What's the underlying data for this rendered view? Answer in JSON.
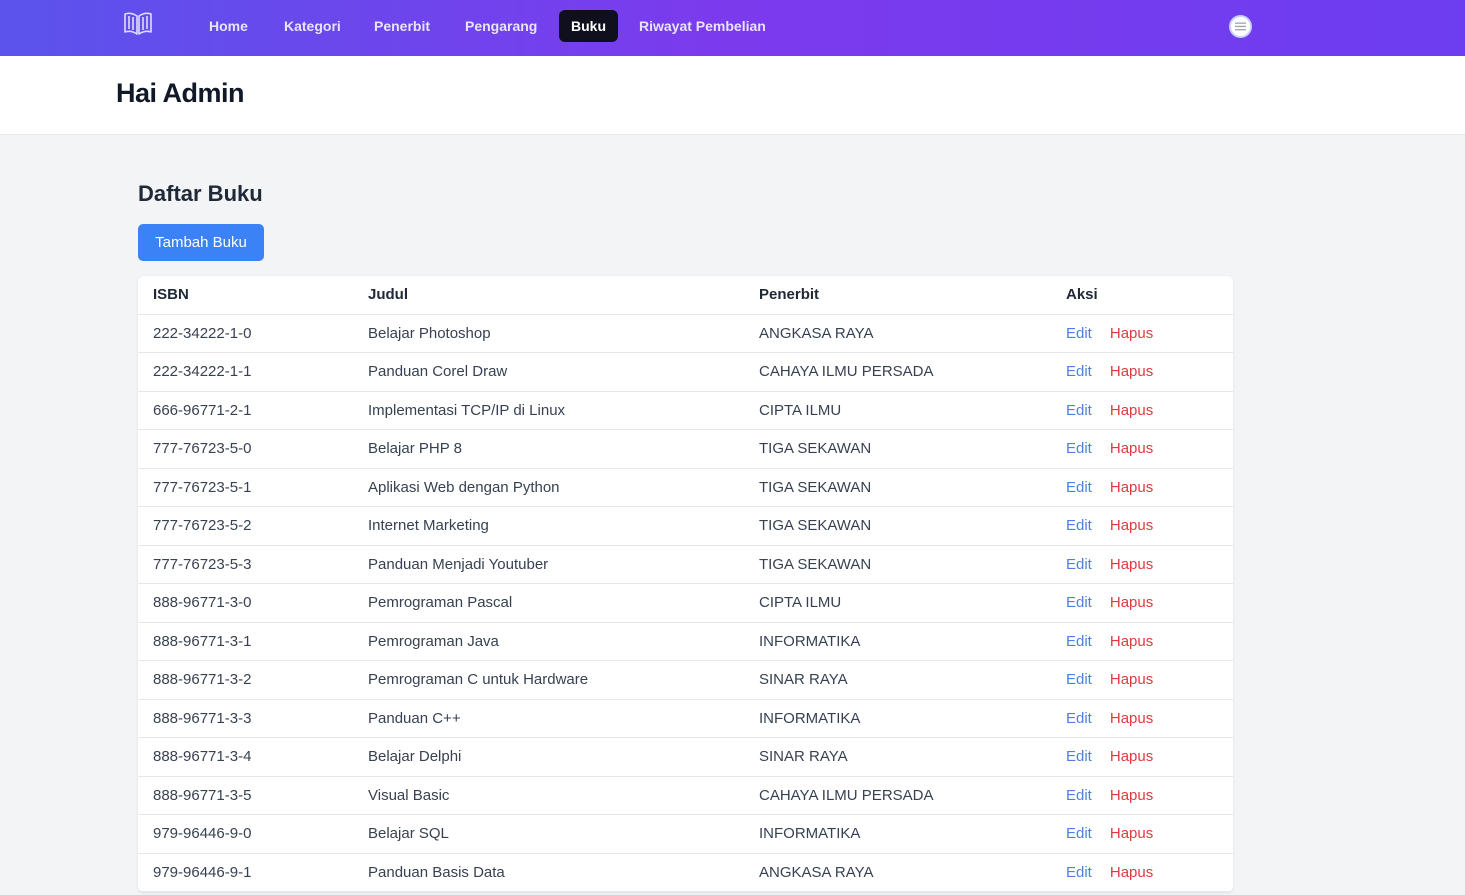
{
  "nav": {
    "items": [
      {
        "label": "Home",
        "active": false
      },
      {
        "label": "Kategori",
        "active": false
      },
      {
        "label": "Penerbit",
        "active": false
      },
      {
        "label": "Pengarang",
        "active": false
      },
      {
        "label": "Buku",
        "active": true
      },
      {
        "label": "Riwayat Pembelian",
        "active": false
      }
    ],
    "logo_icon": "open-book-icon",
    "profile_icon": "menu-lines-icon"
  },
  "header": {
    "title": "Hai Admin"
  },
  "main": {
    "section_title": "Daftar Buku",
    "add_button_label": "Tambah Buku",
    "table": {
      "columns": [
        "ISBN",
        "Judul",
        "Penerbit",
        "Aksi"
      ],
      "edit_label": "Edit",
      "delete_label": "Hapus",
      "rows": [
        {
          "isbn": "222-34222-1-0",
          "judul": "Belajar Photoshop",
          "penerbit": "ANGKASA RAYA"
        },
        {
          "isbn": "222-34222-1-1",
          "judul": "Panduan Corel Draw",
          "penerbit": "CAHAYA ILMU PERSADA"
        },
        {
          "isbn": "666-96771-2-1",
          "judul": "Implementasi TCP/IP di Linux",
          "penerbit": "CIPTA ILMU"
        },
        {
          "isbn": "777-76723-5-0",
          "judul": "Belajar PHP 8",
          "penerbit": "TIGA SEKAWAN"
        },
        {
          "isbn": "777-76723-5-1",
          "judul": "Aplikasi Web dengan Python",
          "penerbit": "TIGA SEKAWAN"
        },
        {
          "isbn": "777-76723-5-2",
          "judul": "Internet Marketing",
          "penerbit": "TIGA SEKAWAN"
        },
        {
          "isbn": "777-76723-5-3",
          "judul": "Panduan Menjadi Youtuber",
          "penerbit": "TIGA SEKAWAN"
        },
        {
          "isbn": "888-96771-3-0",
          "judul": "Pemrograman Pascal",
          "penerbit": "CIPTA ILMU"
        },
        {
          "isbn": "888-96771-3-1",
          "judul": "Pemrograman Java",
          "penerbit": "INFORMATIKA"
        },
        {
          "isbn": "888-96771-3-2",
          "judul": "Pemrograman C untuk Hardware",
          "penerbit": "SINAR RAYA"
        },
        {
          "isbn": "888-96771-3-3",
          "judul": "Panduan C++",
          "penerbit": "INFORMATIKA"
        },
        {
          "isbn": "888-96771-3-4",
          "judul": "Belajar Delphi",
          "penerbit": "SINAR RAYA"
        },
        {
          "isbn": "888-96771-3-5",
          "judul": "Visual Basic",
          "penerbit": "CAHAYA ILMU PERSADA"
        },
        {
          "isbn": "979-96446-9-0",
          "judul": "Belajar SQL",
          "penerbit": "INFORMATIKA"
        },
        {
          "isbn": "979-96446-9-1",
          "judul": "Panduan Basis Data",
          "penerbit": "ANGKASA RAYA"
        }
      ]
    }
  },
  "colors": {
    "nav_gradient_start": "#5b53ec",
    "nav_gradient_end": "#7c3aed",
    "active_tab": "#0f0f1e",
    "primary_button": "#3b82f6",
    "edit_link": "#4f7fe0",
    "delete_link": "#e03b3b"
  }
}
